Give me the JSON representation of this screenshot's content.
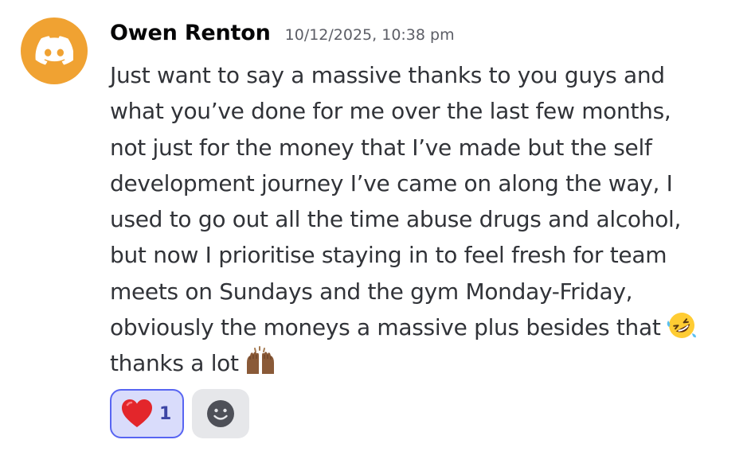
{
  "message": {
    "author": "Owen Renton",
    "timestamp": "10/12/2025, 10:38 pm",
    "avatar_icon": "discord-logo-icon",
    "avatar_color": "#f0a232",
    "lines": [
      "Just want to say a massive thanks to you guys and",
      "what you’ve done for me over the last few months,",
      "not just for the money that I’ve made but the self",
      "development journey I’ve came on along the way, I",
      "used to go out all the time abuse drugs and alcohol,",
      "but now I prioritise staying in to feel fresh for team",
      "meets on Sundays and the gym Monday-Friday,",
      "obviously the moneys a massive plus besides that",
      "thanks a lot"
    ],
    "inline_emojis": [
      "rofl-emoji",
      "raising-hands-emoji"
    ]
  },
  "reactions": [
    {
      "emoji": "red-heart-emoji",
      "count": "1",
      "selected": true
    }
  ],
  "add_reaction_icon": "smiley-add-reaction-icon",
  "colors": {
    "accent": "#5865f2",
    "reaction_bg": "#d9dcfb",
    "username": "#060607",
    "text": "#313338",
    "timestamp": "#5c5e66"
  }
}
